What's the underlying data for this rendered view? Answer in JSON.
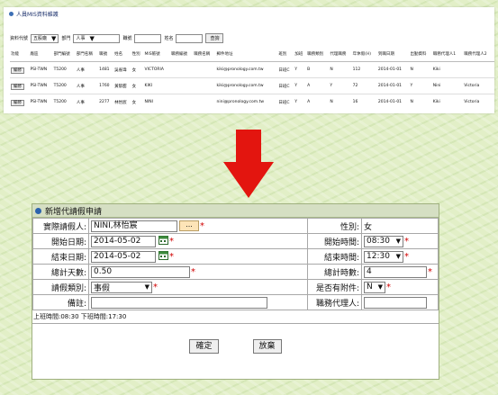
{
  "top": {
    "title": "人員MIS資料維護",
    "filter": {
      "label1": "資料代號",
      "select1": "五股廠",
      "label2": "部門",
      "select2": "人事",
      "label3": "職號",
      "label4": "姓名",
      "button": "查詢"
    },
    "headers": [
      "功能",
      "廠區",
      "部門編號",
      "部門名稱",
      "職號",
      "姓名",
      "性別",
      "MIS帳號",
      "職務編號",
      "職務名稱",
      "郵件地址",
      "班別",
      "加班",
      "職務類別",
      "代理職務",
      "年休假(H)",
      "到職日期",
      "出勤資料",
      "職務代理人1",
      "職務代理人2"
    ],
    "rows": [
      [
        "編修",
        "PSI-TWN",
        "T5200",
        "人事",
        "1481",
        "吳雀瑋",
        "女",
        "VICTORIA",
        "",
        "",
        "kiki@pronology.com.tw",
        "日班C",
        "Y",
        "B",
        "N",
        "112",
        "2014-01-01",
        "N",
        "Kiki",
        ""
      ],
      [
        "編修",
        "PSI-TWN",
        "T5200",
        "人事",
        "1760",
        "黃郁甜",
        "女",
        "KIKI",
        "",
        "",
        "kiki@pronology.com.tw",
        "日班C",
        "Y",
        "A",
        "Y",
        "72",
        "2014-01-01",
        "Y",
        "Nini",
        "Victoria"
      ],
      [
        "編修",
        "PSI-TWN",
        "T5200",
        "人事",
        "2277",
        "林怡宸",
        "女",
        "NINI",
        "",
        "",
        "nini@pronology.com.tw",
        "日班C",
        "Y",
        "A",
        "N",
        "16",
        "2014-01-01",
        "N",
        "Kiki",
        "Victoria"
      ]
    ]
  },
  "form": {
    "title": "新增代請假申請",
    "applicant_label": "實際請假人:",
    "applicant_value": "NINI,林怡宸",
    "picker_label": "...",
    "gender_label": "性別:",
    "gender_value": "女",
    "start_date_label": "開始日期:",
    "start_date": "2014-05-02",
    "start_time_label": "開始時間:",
    "start_time": "08:30",
    "end_date_label": "結束日期:",
    "end_date": "2014-05-02",
    "end_time_label": "結束時間:",
    "end_time": "12:30",
    "total_days_label": "總計天數:",
    "total_days": "0.50",
    "total_hours_label": "總計時數:",
    "total_hours": "4",
    "leave_type_label": "請假類別:",
    "leave_type": "事假",
    "attachment_label": "是否有附件:",
    "attachment": "N",
    "note_label": "備註:",
    "note": "",
    "proxy_label": "職務代理人:",
    "proxy": "",
    "req_mark": "*",
    "schedule": "上班時間:08:30 下班時間:17:30",
    "confirm": "確定",
    "cancel": "放棄"
  },
  "colors": {
    "arrow": "#e3150f",
    "header": "#d5dfc3",
    "background": "#e2efc7"
  }
}
